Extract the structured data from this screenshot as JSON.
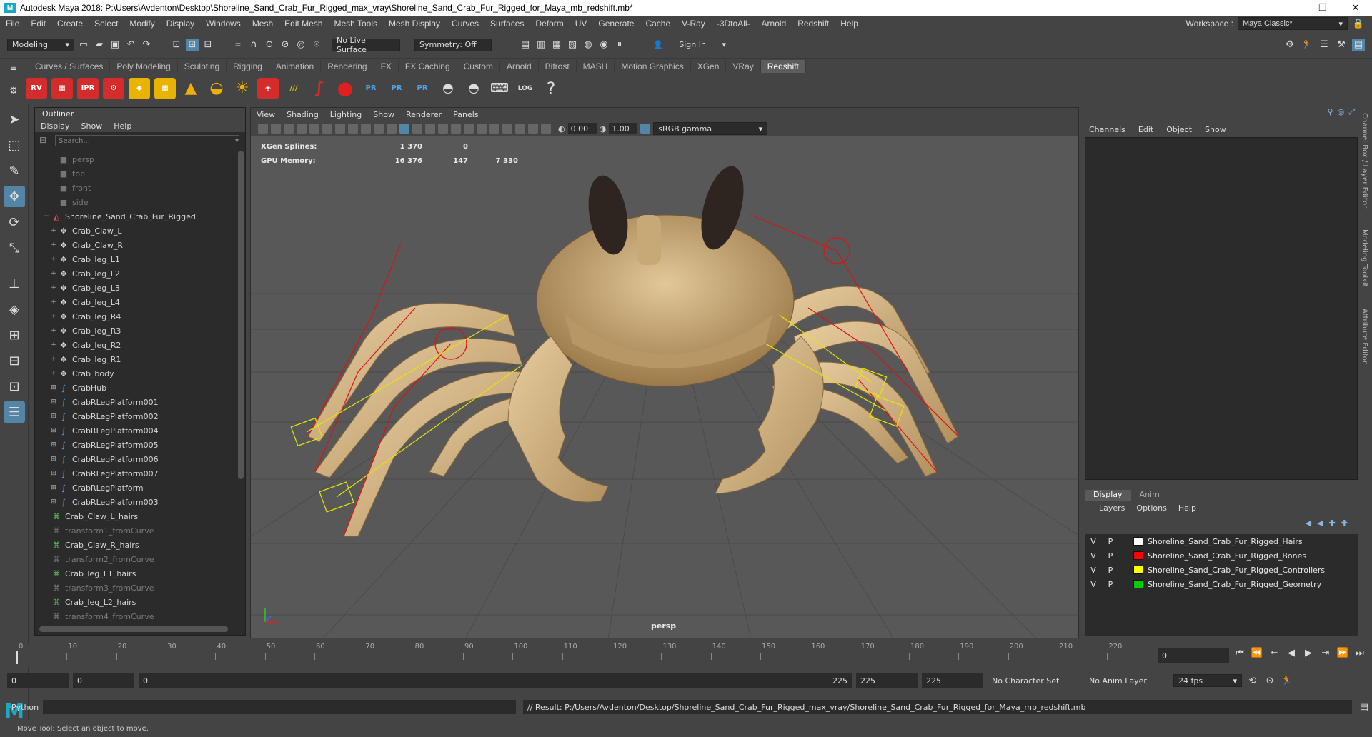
{
  "titlebar": {
    "title": "Autodesk Maya 2018: P:\\Users\\Avdenton\\Desktop\\Shoreline_Sand_Crab_Fur_Rigged_max_vray\\Shoreline_Sand_Crab_Fur_Rigged_for_Maya_mb_redshift.mb*"
  },
  "menubar": {
    "items": [
      "File",
      "Edit",
      "Create",
      "Select",
      "Modify",
      "Display",
      "Windows",
      "Mesh",
      "Edit Mesh",
      "Mesh Tools",
      "Mesh Display",
      "Curves",
      "Surfaces",
      "Deform",
      "UV",
      "Generate",
      "Cache",
      "V-Ray",
      "-3DtoAll-",
      "Arnold",
      "Redshift",
      "Help"
    ],
    "workspace_label": "Workspace :",
    "workspace_value": "Maya Classic*"
  },
  "statusline": {
    "mode": "Modeling",
    "live_surface": "No Live Surface",
    "symmetry": "Symmetry: Off",
    "sign_in": "Sign In"
  },
  "shelf": {
    "tabs": [
      "Curves / Surfaces",
      "Poly Modeling",
      "Sculpting",
      "Rigging",
      "Animation",
      "Rendering",
      "FX",
      "FX Caching",
      "Custom",
      "Arnold",
      "Bifrost",
      "MASH",
      "Motion Graphics",
      "XGen",
      "VRay",
      "Redshift"
    ],
    "active_tab": "Redshift",
    "icon_labels": [
      "RV",
      "IPR",
      "PR",
      "PR",
      "PR",
      "LOG",
      "?"
    ]
  },
  "outliner": {
    "title": "Outliner",
    "menus": [
      "Display",
      "Show",
      "Help"
    ],
    "search_placeholder": "Search...",
    "items": [
      {
        "label": "persp",
        "kind": "camera",
        "dim": true,
        "indent": 1,
        "exp": ""
      },
      {
        "label": "top",
        "kind": "camera",
        "dim": true,
        "indent": 1,
        "exp": ""
      },
      {
        "label": "front",
        "kind": "camera",
        "dim": true,
        "indent": 1,
        "exp": ""
      },
      {
        "label": "side",
        "kind": "camera",
        "dim": true,
        "indent": 1,
        "exp": ""
      },
      {
        "label": "Shoreline_Sand_Crab_Fur_Rigged",
        "kind": "group",
        "dim": false,
        "indent": 0,
        "exp": "−"
      },
      {
        "label": "Crab_Claw_L",
        "kind": "joint",
        "dim": false,
        "indent": 1,
        "exp": "+"
      },
      {
        "label": "Crab_Claw_R",
        "kind": "joint",
        "dim": false,
        "indent": 1,
        "exp": "+"
      },
      {
        "label": "Crab_leg_L1",
        "kind": "joint",
        "dim": false,
        "indent": 1,
        "exp": "+"
      },
      {
        "label": "Crab_leg_L2",
        "kind": "joint",
        "dim": false,
        "indent": 1,
        "exp": "+"
      },
      {
        "label": "Crab_leg_L3",
        "kind": "joint",
        "dim": false,
        "indent": 1,
        "exp": "+"
      },
      {
        "label": "Crab_leg_L4",
        "kind": "joint",
        "dim": false,
        "indent": 1,
        "exp": "+"
      },
      {
        "label": "Crab_leg_R4",
        "kind": "joint",
        "dim": false,
        "indent": 1,
        "exp": "+"
      },
      {
        "label": "Crab_leg_R3",
        "kind": "joint",
        "dim": false,
        "indent": 1,
        "exp": "+"
      },
      {
        "label": "Crab_leg_R2",
        "kind": "joint",
        "dim": false,
        "indent": 1,
        "exp": "+"
      },
      {
        "label": "Crab_leg_R1",
        "kind": "joint",
        "dim": false,
        "indent": 1,
        "exp": "+"
      },
      {
        "label": "Crab_body",
        "kind": "joint",
        "dim": false,
        "indent": 1,
        "exp": "+"
      },
      {
        "label": "CrabHub",
        "kind": "curve",
        "dim": false,
        "indent": 1,
        "exp": "⊞"
      },
      {
        "label": "CrabRLegPlatform001",
        "kind": "curve",
        "dim": false,
        "indent": 1,
        "exp": "⊞"
      },
      {
        "label": "CrabRLegPlatform002",
        "kind": "curve",
        "dim": false,
        "indent": 1,
        "exp": "⊞"
      },
      {
        "label": "CrabRLegPlatform004",
        "kind": "curve",
        "dim": false,
        "indent": 1,
        "exp": "⊞"
      },
      {
        "label": "CrabRLegPlatform005",
        "kind": "curve",
        "dim": false,
        "indent": 1,
        "exp": "⊞"
      },
      {
        "label": "CrabRLegPlatform006",
        "kind": "curve",
        "dim": false,
        "indent": 1,
        "exp": "⊞"
      },
      {
        "label": "CrabRLegPlatform007",
        "kind": "curve",
        "dim": false,
        "indent": 1,
        "exp": "⊞"
      },
      {
        "label": "CrabRLegPlatform",
        "kind": "curve",
        "dim": false,
        "indent": 1,
        "exp": "⊞"
      },
      {
        "label": "CrabRLegPlatform003",
        "kind": "curve",
        "dim": false,
        "indent": 1,
        "exp": "⊞"
      },
      {
        "label": "Crab_Claw_L_hairs",
        "kind": "hair",
        "dim": false,
        "indent": 0,
        "exp": ""
      },
      {
        "label": "transform1_fromCurve",
        "kind": "hair",
        "dim": true,
        "indent": 0,
        "exp": ""
      },
      {
        "label": "Crab_Claw_R_hairs",
        "kind": "hair",
        "dim": false,
        "indent": 0,
        "exp": ""
      },
      {
        "label": "transform2_fromCurve",
        "kind": "hair",
        "dim": true,
        "indent": 0,
        "exp": ""
      },
      {
        "label": "Crab_leg_L1_hairs",
        "kind": "hair",
        "dim": false,
        "indent": 0,
        "exp": ""
      },
      {
        "label": "transform3_fromCurve",
        "kind": "hair",
        "dim": true,
        "indent": 0,
        "exp": ""
      },
      {
        "label": "Crab_leg_L2_hairs",
        "kind": "hair",
        "dim": false,
        "indent": 0,
        "exp": ""
      },
      {
        "label": "transform4_fromCurve",
        "kind": "hair",
        "dim": true,
        "indent": 0,
        "exp": ""
      }
    ]
  },
  "viewport": {
    "menus": [
      "View",
      "Shading",
      "Lighting",
      "Show",
      "Renderer",
      "Panels"
    ],
    "exposure": "0.00",
    "gamma": "1.00",
    "colorspace": "sRGB gamma",
    "hud": [
      {
        "label": "XGen Splines:",
        "a": "1 370",
        "b": "0",
        "c": ""
      },
      {
        "label": "GPU Memory:",
        "a": "16 376",
        "b": "147",
        "c": "7 330"
      }
    ],
    "camera_label": "persp"
  },
  "channelbox": {
    "menus": [
      "Channels",
      "Edit",
      "Object",
      "Show"
    ],
    "side_tabs": [
      "Channel Box / Layer Editor",
      "Modeling Toolkit",
      "Attribute Editor"
    ]
  },
  "layereditor": {
    "tabs": [
      "Display",
      "Anim"
    ],
    "menus": [
      "Layers",
      "Options",
      "Help"
    ],
    "layers": [
      {
        "v": "V",
        "p": "P",
        "name": "Shoreline_Sand_Crab_Fur_Rigged_Hairs",
        "color": "#ffffff"
      },
      {
        "v": "V",
        "p": "P",
        "name": "Shoreline_Sand_Crab_Fur_Rigged_Bones",
        "color": "#ff0000"
      },
      {
        "v": "V",
        "p": "P",
        "name": "Shoreline_Sand_Crab_Fur_Rigged_Controllers",
        "color": "#ffff00"
      },
      {
        "v": "V",
        "p": "P",
        "name": "Shoreline_Sand_Crab_Fur_Rigged_Geometry",
        "color": "#00cc00"
      }
    ]
  },
  "timeslider": {
    "ticks": [
      0,
      10,
      20,
      30,
      40,
      50,
      60,
      70,
      80,
      90,
      100,
      110,
      120,
      130,
      140,
      150,
      160,
      170,
      180,
      190,
      200,
      210,
      220
    ],
    "current_frame": "0"
  },
  "range": {
    "start": "0",
    "anim_start": "0",
    "slider_start": "0",
    "slider_end": "225",
    "anim_end": "225",
    "end": "225",
    "character_set": "No Character Set",
    "anim_layer": "No Anim Layer",
    "fps": "24 fps"
  },
  "cmdline": {
    "lang": "Python",
    "result": "// Result: P:/Users/Avdenton/Desktop/Shoreline_Sand_Crab_Fur_Rigged_max_vray/Shoreline_Sand_Crab_Fur_Rigged_for_Maya_mb_redshift.mb"
  },
  "helpline": {
    "text": "Move Tool: Select an object to move."
  }
}
